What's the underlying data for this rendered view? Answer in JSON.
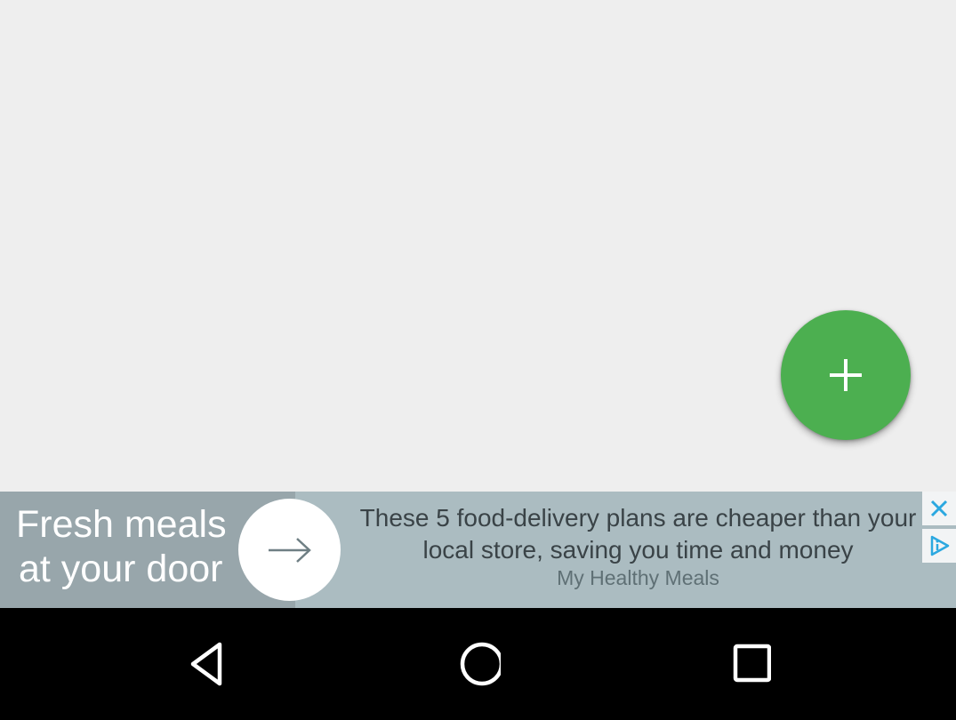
{
  "fab": {
    "label": "+",
    "color": "#4caf50",
    "icon": "plus-icon"
  },
  "ad": {
    "left_text": [
      "Fresh meals",
      "at your door"
    ],
    "headline": "These 5 food-delivery plans are cheaper than your local store, saving you time and money",
    "source": "My Healthy Meals",
    "icons": {
      "arrow": "arrow-right-icon",
      "close": "close-icon",
      "adchoices": "adchoices-icon"
    },
    "colors": {
      "background": "#abbcc1",
      "left_panel": "#98a6ab",
      "adchoices_accent": "#2ba8e0"
    }
  },
  "nav": {
    "back": "back-triangle-icon",
    "home": "home-circle-icon",
    "recents": "recents-square-icon"
  }
}
